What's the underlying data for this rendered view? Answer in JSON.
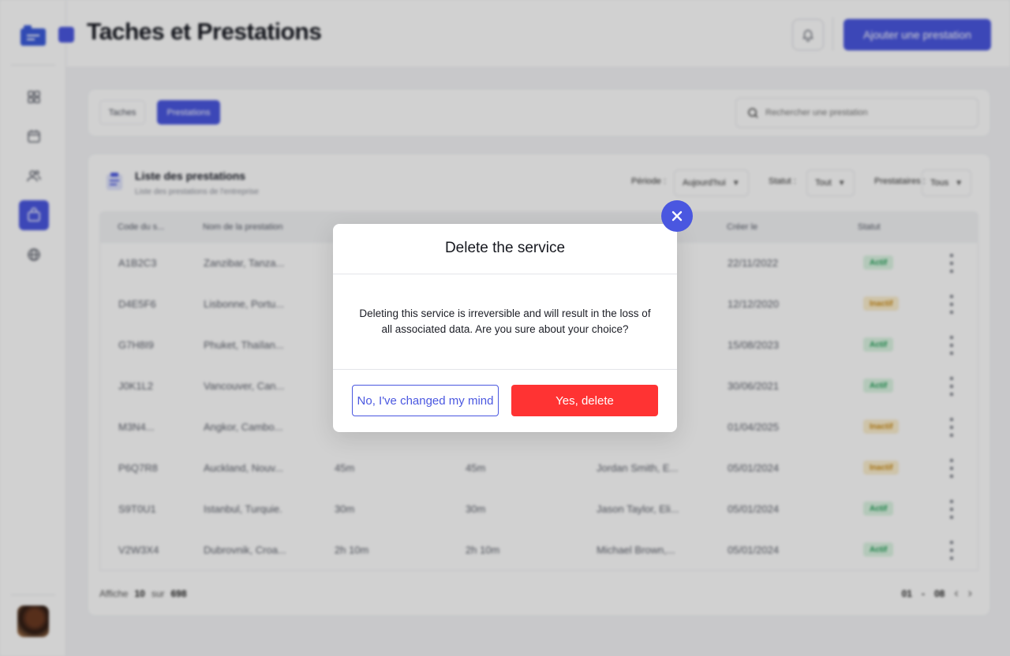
{
  "header": {
    "title": "Taches et Prestations",
    "add_button": "Ajouter une prestation"
  },
  "sidebar": {
    "items": [
      {
        "icon": "grid-icon"
      },
      {
        "icon": "calendar-icon"
      },
      {
        "icon": "users-icon"
      },
      {
        "icon": "bag-icon",
        "active": true
      },
      {
        "icon": "globe-icon"
      }
    ]
  },
  "filters": {
    "tabs": [
      "Taches",
      "Prestations"
    ],
    "active_tab": "Prestations",
    "search_placeholder": "Rechercher une prestation"
  },
  "list": {
    "title": "Liste des prestations",
    "subtitle": "Liste des prestations de l'entreprise",
    "period_label": "Période :",
    "period_value": "Aujourd'hui",
    "status_label": "Statut :",
    "status_value": "Tout",
    "provider_label": "Prestataires :",
    "provider_value": "Tous",
    "columns": [
      "Code du s...",
      "Nom de la prestation",
      "",
      "",
      "",
      "Créer le",
      "Statut"
    ],
    "rows": [
      {
        "code": "A1B2C3",
        "name": "Zanzibar, Tanza...",
        "d1": "",
        "d2": "",
        "person": "",
        "date": "22/11/2022",
        "status": "Actif"
      },
      {
        "code": "D4E5F6",
        "name": "Lisbonne, Portu...",
        "d1": "",
        "d2": "",
        "person": "",
        "date": "12/12/2020",
        "status": "Inactif"
      },
      {
        "code": "G7H8I9",
        "name": "Phuket, Thaïlan...",
        "d1": "",
        "d2": "",
        "person": "",
        "date": "15/08/2023",
        "status": "Actif"
      },
      {
        "code": "J0K1L2",
        "name": "Vancouver, Can...",
        "d1": "",
        "d2": "",
        "person": "",
        "date": "30/06/2021",
        "status": "Actif"
      },
      {
        "code": "M3N4...",
        "name": "Angkor, Cambo...",
        "d1": "",
        "d2": "",
        "person": "",
        "date": "01/04/2025",
        "status": "Inactif"
      },
      {
        "code": "P6Q7R8",
        "name": "Auckland, Nouv...",
        "d1": "45m",
        "d2": "45m",
        "person": "Jordan Smith, E...",
        "date": "05/01/2024",
        "status": "Inactif"
      },
      {
        "code": "S9T0U1",
        "name": "Istanbul, Turquie.",
        "d1": "30m",
        "d2": "30m",
        "person": "Jason Taylor, Eli...",
        "date": "05/01/2024",
        "status": "Actif"
      },
      {
        "code": "V2W3X4",
        "name": "Dubrovnik, Croa...",
        "d1": "2h 10m",
        "d2": "2h 10m",
        "person": "Michael Brown,...",
        "date": "05/01/2024",
        "status": "Actif"
      }
    ],
    "footer": {
      "show_label": "Affiche",
      "show_count": "10",
      "of_label": "sur",
      "total": "698",
      "page_from": "01",
      "page_sep": "-",
      "page_to": "08"
    }
  },
  "modal": {
    "title": "Delete the service",
    "body": "Deleting this service is irreversible and will result in the loss of all associated data. Are you sure about your choice?",
    "cancel_label": "No, I've changed my mind",
    "confirm_label": "Yes, delete"
  },
  "colors": {
    "primary": "#4a57e0",
    "danger": "#ff3333",
    "active_badge": "#1f9d55",
    "inactive_badge": "#c98a13"
  }
}
